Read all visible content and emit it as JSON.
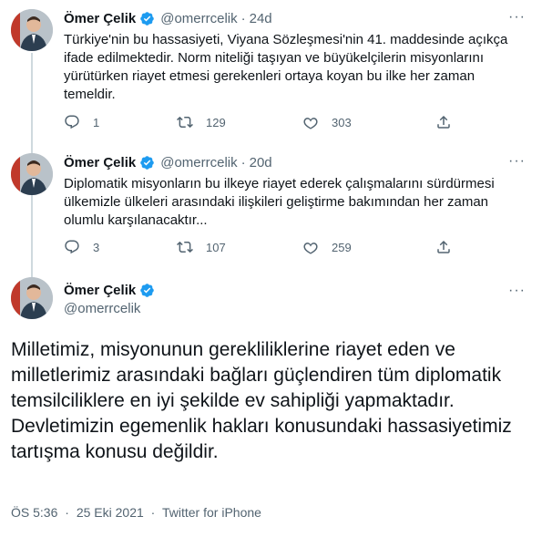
{
  "tweets": [
    {
      "name": "Ömer Çelik",
      "handle": "@omerrcelik",
      "separator": "·",
      "time": "24d",
      "text": "Türkiye'nin bu hassasiyeti, Viyana Sözleşmesi'nin 41. maddesinde açıkça ifade edilmektedir. Norm niteliği taşıyan ve büyükelçilerin misyonlarını yürütürken riayet etmesi gerekenleri ortaya koyan bu ilke her zaman temeldir.",
      "replies": "1",
      "retweets": "129",
      "likes": "303"
    },
    {
      "name": "Ömer Çelik",
      "handle": "@omerrcelik",
      "separator": "·",
      "time": "20d",
      "text": "Diplomatik misyonların bu ilkeye riayet ederek çalışmalarını sürdürmesi ülkemizle ülkeleri arasındaki ilişkileri geliştirme bakımından her zaman olumlu karşılanacaktır...",
      "replies": "3",
      "retweets": "107",
      "likes": "259"
    }
  ],
  "main_tweet": {
    "name": "Ömer Çelik",
    "handle": "@omerrcelik",
    "text": "Milletimiz, misyonunun gerekliliklerine riayet eden ve milletlerimiz arasındaki bağları güçlendiren tüm diplomatik temsilciliklere en iyi şekilde ev sahipliği yapmaktadır.\nDevletimizin egemenlik hakları konusundaki hassasiyetimiz tartışma konusu değildir.",
    "time": "ÖS 5:36",
    "separator": "·",
    "date": "25 Eki 2021",
    "source": "Twitter for iPhone"
  },
  "icons": {
    "more": "more-icon",
    "verified": "verified-badge-icon",
    "reply": "reply-icon",
    "retweet": "retweet-icon",
    "like": "like-icon",
    "share": "share-icon"
  },
  "colors": {
    "verified_blue": "#1d9bf0",
    "secondary_text": "#536471",
    "thread_line": "#cfd9de"
  }
}
